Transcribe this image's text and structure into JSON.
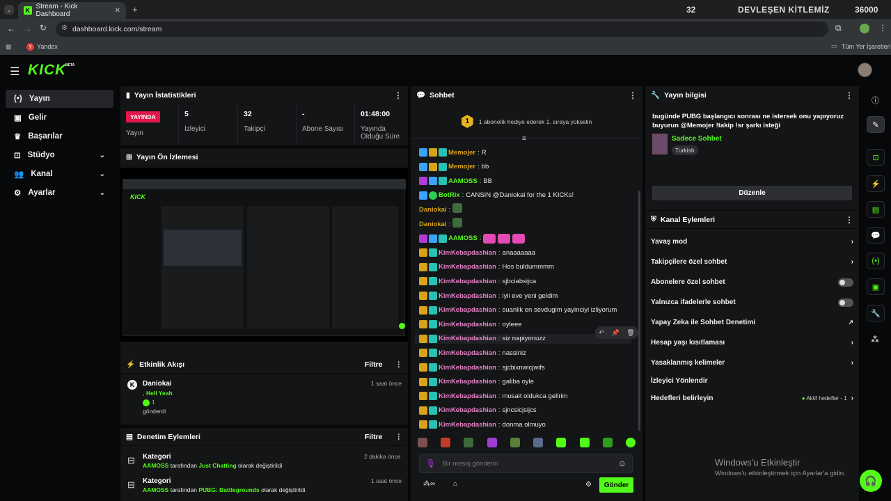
{
  "browser": {
    "tab_title": "Stream - Kick Dashboard",
    "url": "dashboard.kick.com/stream",
    "bookmark": "Yandex",
    "bookmarks_right": "Tüm Yer İşaretleri",
    "overlay_left": "32",
    "overlay_title": "DEVLEŞEN KİTLEMİZ",
    "overlay_right": "36000"
  },
  "app": {
    "logo": "KICK",
    "logo_badge": "BETA"
  },
  "sidebar": {
    "items": [
      {
        "label": "Yayın",
        "icon": "broadcast-icon",
        "active": true
      },
      {
        "label": "Gelir",
        "icon": "wallet-icon"
      },
      {
        "label": "Başarılar",
        "icon": "trophy-icon"
      },
      {
        "label": "Stüdyo",
        "icon": "studio-icon",
        "expand": true
      },
      {
        "label": "Kanal",
        "icon": "users-icon",
        "expand": true
      },
      {
        "label": "Ayarlar",
        "icon": "gear-icon",
        "expand": true
      }
    ]
  },
  "stats": {
    "title": "Yayın İstatistikleri",
    "live_badge": "YAYINDA",
    "live_label": "Yayın",
    "items": [
      {
        "value": "5",
        "label": "İzleyici"
      },
      {
        "value": "32",
        "label": "Takipçi"
      },
      {
        "value": "-",
        "label": "Abone Sayısı"
      },
      {
        "value": "01:48:00",
        "label": "Yayında Olduğu Süre"
      }
    ]
  },
  "preview": {
    "title": "Yayın Ön İzlemesi"
  },
  "activity": {
    "title": "Etkinlik Akışı",
    "filter": "Filtre",
    "items": [
      {
        "user": "Daniokai",
        "line1": ",",
        "highlight": "Hell Yeah",
        "count": "1",
        "line2": "gönderdi",
        "time": "1 saat önce"
      }
    ]
  },
  "moderation": {
    "title": "Denetim Eylemleri",
    "filter": "Filtre",
    "items": [
      {
        "title": "Kategori",
        "user": "AAMOSS",
        "mid": "tarafından",
        "cat": "Just Chatting",
        "end": "olarak değiştirildi",
        "time": "2 dakika önce"
      },
      {
        "title": "Kategori",
        "user": "AAMOSS",
        "mid": "tarafından",
        "cat": "PUBG: Battlegrounds",
        "end": "olarak değiştirildi",
        "time": "1 saat önce"
      }
    ]
  },
  "chat": {
    "title": "Sohbet",
    "gift_rank": "1",
    "gift_text": "1 abonelik hediye ederek 1. sıraya yükselin",
    "messages": [
      {
        "user": "Memojer",
        "text": "R",
        "color": "#d9a21b",
        "badges": "bgt"
      },
      {
        "user": "Memojer",
        "text": "bb",
        "color": "#d9a21b",
        "badges": "bgt"
      },
      {
        "user": "AAMOSS",
        "text": "BB",
        "color": "#53fc18",
        "badges": "pbt"
      },
      {
        "user": "BotRix",
        "text": "CANSIN @Daniokai for the 1 KICKs!",
        "color": "#53fc18",
        "badges": "bv"
      },
      {
        "user": "Daniokai",
        "text": "",
        "color": "#d9a21b",
        "badges": ""
      },
      {
        "user": "Daniokai",
        "text": "",
        "color": "#d9a21b",
        "badges": ""
      },
      {
        "user": "AAMOSS",
        "text": "",
        "color": "#53fc18",
        "badges": "pbt"
      },
      {
        "user": "KimKebapdashian",
        "text": "anaaaaaaa",
        "color": "#e882c8",
        "badges": "gt"
      },
      {
        "user": "KimKebapdashian",
        "text": "Hos buldummmm",
        "color": "#e882c8",
        "badges": "gt"
      },
      {
        "user": "KimKebapdashian",
        "text": "sjbciabsijca",
        "color": "#e882c8",
        "badges": "gt"
      },
      {
        "user": "KimKebapdashian",
        "text": "iyii eve yeni geldim",
        "color": "#e882c8",
        "badges": "gt"
      },
      {
        "user": "KimKebapdashian",
        "text": "suanlik en sevdugim yayinciyi izliyorum",
        "color": "#e882c8",
        "badges": "gt"
      },
      {
        "user": "KimKebapdashian",
        "text": "oyleee",
        "color": "#e882c8",
        "badges": "gt"
      },
      {
        "user": "KimKebapdashian",
        "text": "siz napiyonuzz",
        "color": "#e882c8",
        "badges": "gt"
      },
      {
        "user": "KimKebapdashian",
        "text": "nassiniz",
        "color": "#e882c8",
        "badges": "gt"
      },
      {
        "user": "KimKebapdashian",
        "text": "sjcbixnwicjwifs",
        "color": "#e882c8",
        "badges": "gt"
      },
      {
        "user": "KimKebapdashian",
        "text": "galiba oyle",
        "color": "#e882c8",
        "badges": "gt"
      },
      {
        "user": "KimKebapdashian",
        "text": "musait oldukca gelirim",
        "color": "#e882c8",
        "badges": "gt"
      },
      {
        "user": "KimKebapdashian",
        "text": "sjncsicjsijcs",
        "color": "#e882c8",
        "badges": "gt"
      },
      {
        "user": "KimKebapdashian",
        "text": "donma olmuyo",
        "color": "#e882c8",
        "badges": "gt"
      }
    ],
    "placeholder": "Bir mesaj gönderin",
    "send": "Gönder"
  },
  "info": {
    "title": "Yayın bilgisi",
    "description": "bugünde PUBG başlangıcı sonrası ne istersek onu yapıyoruz buyurun @Memojer !takip !sr şarkı isteği",
    "category": "Sadece Sohbet",
    "language": "Turkish",
    "edit": "Düzenle"
  },
  "channel_actions": {
    "title": "Kanal Eylemleri",
    "items": [
      {
        "label": "Yavaş mod",
        "control": "chevron"
      },
      {
        "label": "Takipçilere özel sohbet",
        "control": "chevron"
      },
      {
        "label": "Abonelere özel sohbet",
        "control": "toggle"
      },
      {
        "label": "Yalnızca ifadelerle sohbet",
        "control": "toggle"
      },
      {
        "label": "Yapay Zeka ile Sohbet Denetimi",
        "control": "external"
      },
      {
        "label": "Hesap yaşı kısıtlaması",
        "control": "chevron"
      },
      {
        "label": "Yasaklanmış kelimeler",
        "control": "chevron"
      },
      {
        "label": "İzleyici Yönlendir",
        "control": "none"
      },
      {
        "label": "Hedefleri belirleyin",
        "control": "chevron",
        "status": "Aktif hedefler - 1"
      }
    ]
  },
  "watermark": {
    "title": "Windows'u Etkinleştir",
    "sub": "Windows'u etkinleştirmek için Ayarlar'a gidin."
  },
  "colors": {
    "accent": "#53fc18",
    "live": "#e0184b",
    "panel": "#141517"
  }
}
